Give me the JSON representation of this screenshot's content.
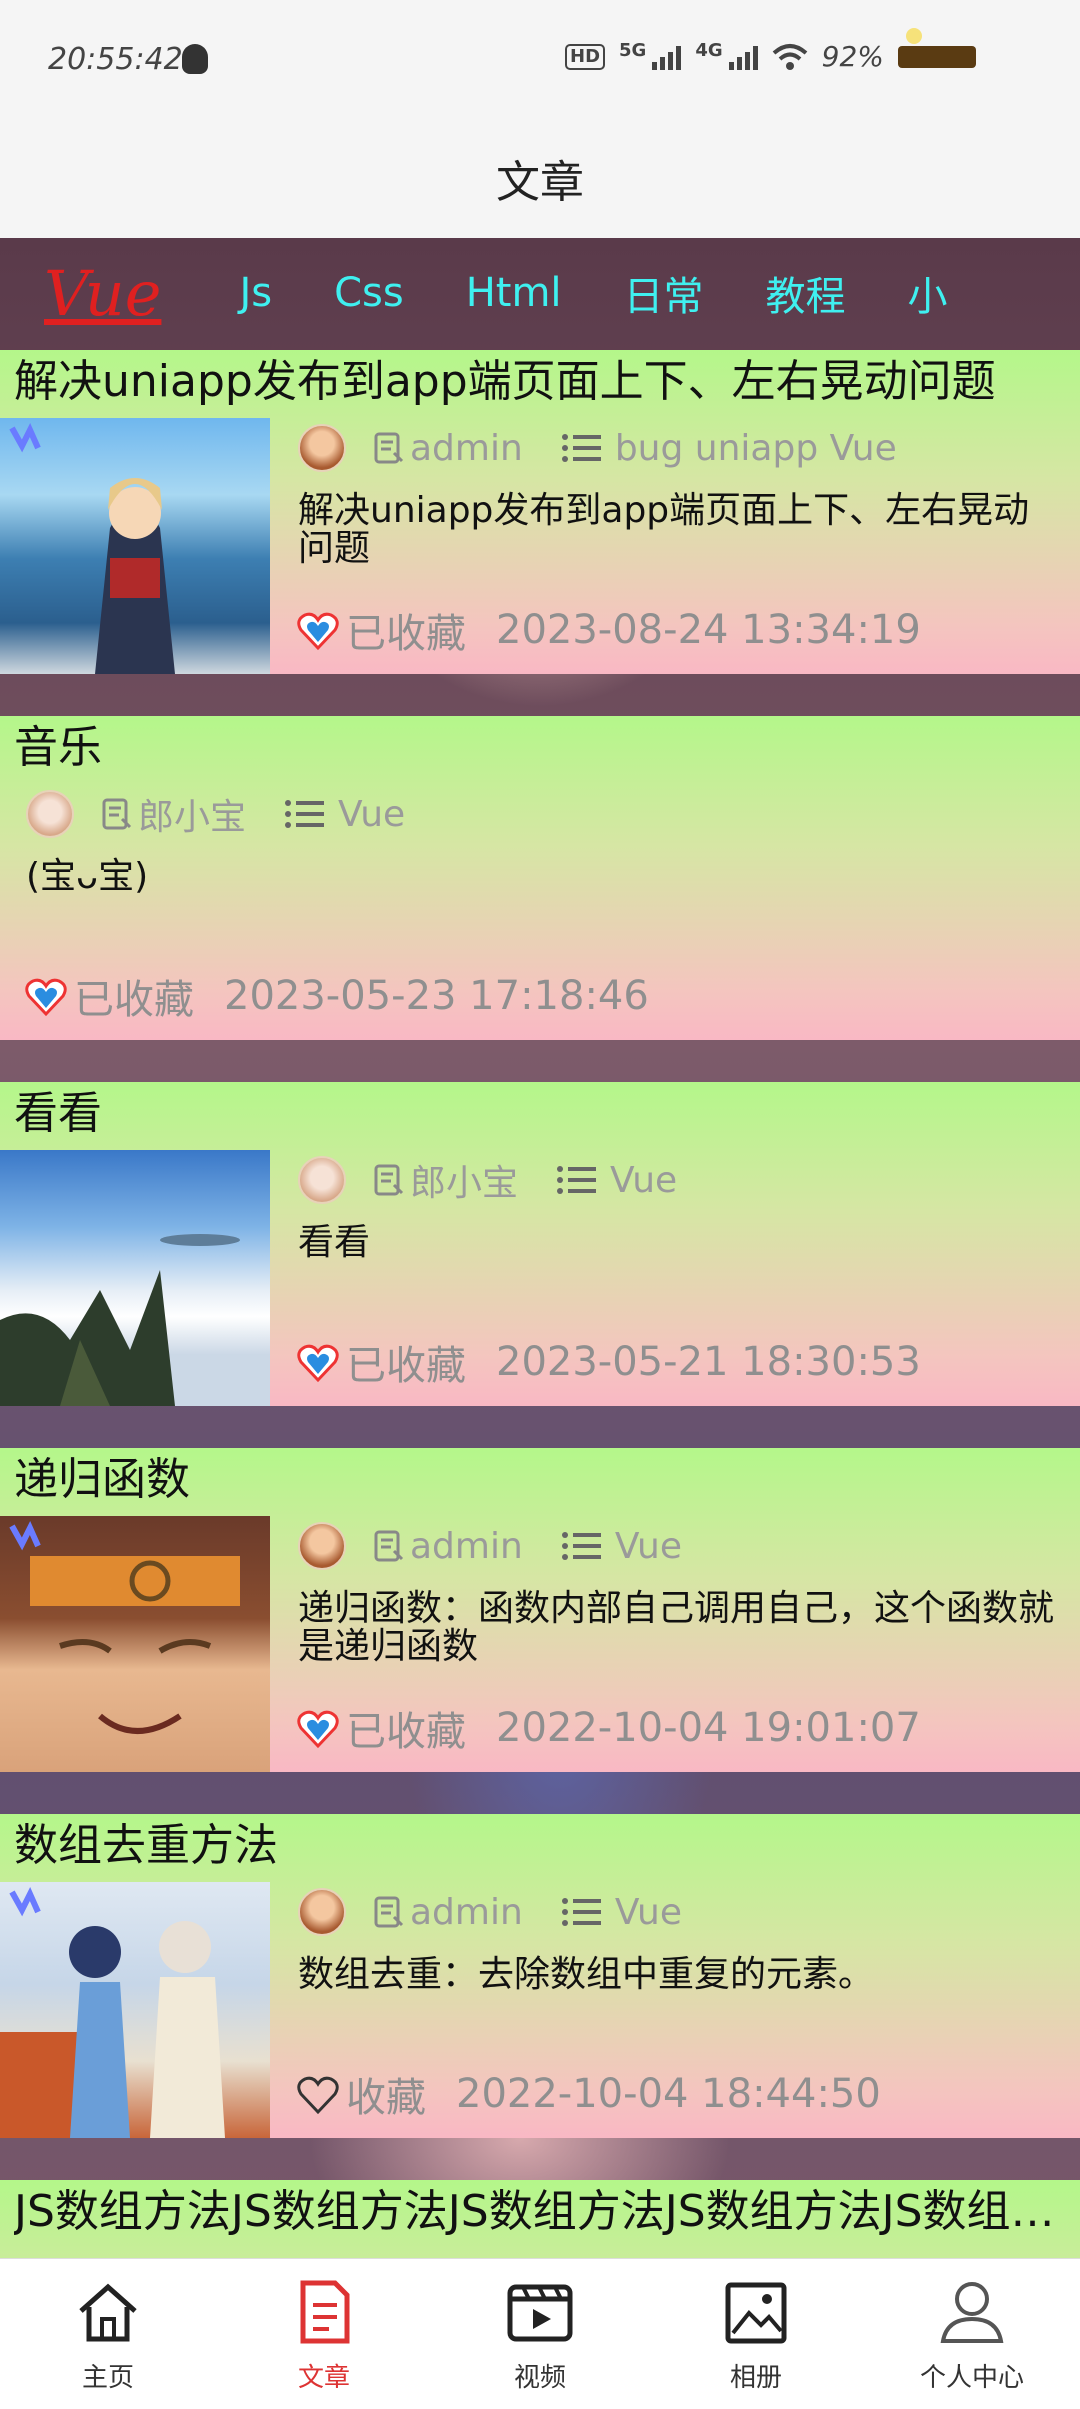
{
  "status_bar": {
    "time": "20:55:42",
    "hd_label": "HD",
    "net_5g": "5G",
    "net_4g": "4G",
    "battery": "92%"
  },
  "header": {
    "title": "文章"
  },
  "category_tabs": [
    {
      "label": "Vue",
      "active": true
    },
    {
      "label": "Js"
    },
    {
      "label": "Css"
    },
    {
      "label": "Html"
    },
    {
      "label": "日常"
    },
    {
      "label": "教程"
    },
    {
      "label": "小"
    }
  ],
  "articles": [
    {
      "title": "解决uniapp发布到app端页面上下、左右晃动问题",
      "author": "admin",
      "tags": "bug uniapp Vue",
      "summary": "解决uniapp发布到app端页面上下、左右晃动问题",
      "fav_label": "已收藏",
      "favorited": true,
      "date": "2023-08-24 13:34:19",
      "has_thumb": true
    },
    {
      "title": "音乐",
      "author": "郎小宝",
      "tags": "Vue",
      "summary": "(宝ᴗ宝)",
      "fav_label": "已收藏",
      "favorited": true,
      "date": "2023-05-23 17:18:46",
      "has_thumb": false
    },
    {
      "title": "看看",
      "author": "郎小宝",
      "tags": "Vue",
      "summary": "看看",
      "fav_label": "已收藏",
      "favorited": true,
      "date": "2023-05-21 18:30:53",
      "has_thumb": true
    },
    {
      "title": "递归函数",
      "author": "admin",
      "tags": "Vue",
      "summary": "递归函数：函数内部自己调用自己，这个函数就是递归函数",
      "fav_label": "已收藏",
      "favorited": true,
      "date": "2022-10-04 19:01:07",
      "has_thumb": true
    },
    {
      "title": "数组去重方法",
      "author": "admin",
      "tags": "Vue",
      "summary": "数组去重：去除数组中重复的元素。",
      "fav_label": "收藏",
      "favorited": false,
      "date": "2022-10-04 18:44:50",
      "has_thumb": true
    },
    {
      "title": "JS数组方法JS数组方法JS数组方法JS数组方法JS数组方法"
    }
  ],
  "tabbar": [
    {
      "label": "主页",
      "icon": "home-icon"
    },
    {
      "label": "文章",
      "icon": "article-icon",
      "active": true
    },
    {
      "label": "视频",
      "icon": "video-icon"
    },
    {
      "label": "相册",
      "icon": "album-icon"
    },
    {
      "label": "个人中心",
      "icon": "user-icon"
    }
  ],
  "colors": {
    "tab_active": "#e02020",
    "tab_inactive": "#3ff0f0",
    "tabbar_active": "#d33"
  }
}
